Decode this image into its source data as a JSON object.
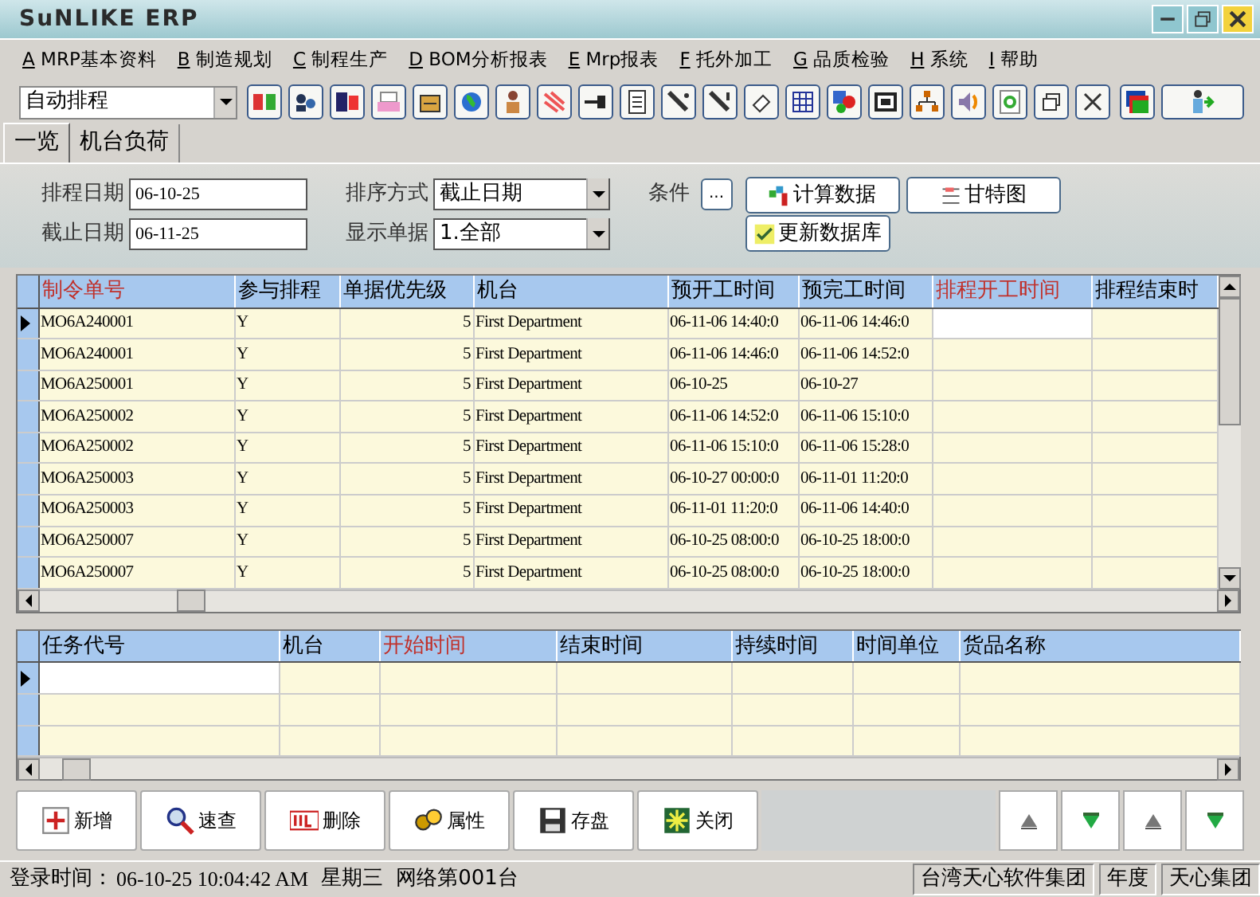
{
  "window": {
    "title": "SuNLIKE ERP"
  },
  "menu": [
    {
      "key": "A",
      "label": "MRP基本资料"
    },
    {
      "key": "B",
      "label": "制造规划"
    },
    {
      "key": "C",
      "label": "制程生产"
    },
    {
      "key": "D",
      "label": "BOM分析报表"
    },
    {
      "key": "E",
      "label": "Mrp报表"
    },
    {
      "key": "F",
      "label": "托外加工"
    },
    {
      "key": "G",
      "label": "品质检验"
    },
    {
      "key": "H",
      "label": "系统"
    },
    {
      "key": "I",
      "label": "帮助"
    }
  ],
  "toolbar": {
    "function_select": {
      "value": "自动排程"
    }
  },
  "tabs": [
    {
      "label": "一览",
      "selected": true
    },
    {
      "label": "机台负荷",
      "selected": false
    }
  ],
  "form": {
    "schedule_date": {
      "label": "排程日期",
      "value": "06-10-25"
    },
    "deadline": {
      "label": "截止日期",
      "value": "06-11-25"
    },
    "sort": {
      "label": "排序方式",
      "value": "截止日期"
    },
    "display": {
      "label": "显示单据",
      "value": "1.全部"
    },
    "condition": {
      "label": "条件",
      "button": "..."
    },
    "actions": [
      {
        "label": "计算数据",
        "kind": "calc"
      },
      {
        "label": "甘特图",
        "kind": "gantt"
      },
      {
        "label": "更新数据库",
        "kind": "update"
      }
    ]
  },
  "orders_table": {
    "columns": [
      {
        "label": "制令单号",
        "highlighted": true,
        "numeric": false,
        "current": false
      },
      {
        "label": "参与排程",
        "highlighted": false,
        "numeric": false,
        "current": false
      },
      {
        "label": "单据优先级",
        "highlighted": false,
        "numeric": true,
        "current": false
      },
      {
        "label": "机台",
        "highlighted": false,
        "numeric": false,
        "current": false
      },
      {
        "label": "预开工时间",
        "highlighted": false,
        "numeric": false,
        "current": false
      },
      {
        "label": "预完工时间",
        "highlighted": false,
        "numeric": false,
        "current": false
      },
      {
        "label": "排程开工时间",
        "highlighted": true,
        "numeric": false,
        "current": true
      },
      {
        "label": "排程结束时",
        "highlighted": false,
        "numeric": false,
        "current": false
      }
    ],
    "rows": [
      {
        "selected": true,
        "cells": [
          "MO6A240001",
          "Y",
          "5",
          "First Department",
          "06-11-06 14:40:0",
          "06-11-06 14:46:0",
          "",
          ""
        ]
      },
      {
        "selected": false,
        "cells": [
          "MO6A240001",
          "Y",
          "5",
          "First Department",
          "06-11-06 14:46:0",
          "06-11-06 14:52:0",
          "",
          ""
        ]
      },
      {
        "selected": false,
        "cells": [
          "MO6A250001",
          "Y",
          "5",
          "First Department",
          "06-10-25",
          "06-10-27",
          "",
          ""
        ]
      },
      {
        "selected": false,
        "cells": [
          "MO6A250002",
          "Y",
          "5",
          "First Department",
          "06-11-06 14:52:0",
          "06-11-06 15:10:0",
          "",
          ""
        ]
      },
      {
        "selected": false,
        "cells": [
          "MO6A250002",
          "Y",
          "5",
          "First Department",
          "06-11-06 15:10:0",
          "06-11-06 15:28:0",
          "",
          ""
        ]
      },
      {
        "selected": false,
        "cells": [
          "MO6A250003",
          "Y",
          "5",
          "First Department",
          "06-10-27 00:00:0",
          "06-11-01 11:20:0",
          "",
          ""
        ]
      },
      {
        "selected": false,
        "cells": [
          "MO6A250003",
          "Y",
          "5",
          "First Department",
          "06-11-01 11:20:0",
          "06-11-06 14:40:0",
          "",
          ""
        ]
      },
      {
        "selected": false,
        "cells": [
          "MO6A250007",
          "Y",
          "5",
          "First Department",
          "06-10-25 08:00:0",
          "06-10-25 18:00:0",
          "",
          ""
        ]
      },
      {
        "selected": false,
        "cells": [
          "MO6A250007",
          "Y",
          "5",
          "First Department",
          "06-10-25 08:00:0",
          "06-10-25 18:00:0",
          "",
          ""
        ]
      }
    ]
  },
  "tasks_table": {
    "columns": [
      {
        "label": "任务代号",
        "highlighted": false,
        "current": true
      },
      {
        "label": "机台",
        "highlighted": false,
        "current": false
      },
      {
        "label": "开始时间",
        "highlighted": true,
        "current": false
      },
      {
        "label": "结束时间",
        "highlighted": false,
        "current": false
      },
      {
        "label": "持续时间",
        "highlighted": false,
        "current": false
      },
      {
        "label": "时间单位",
        "highlighted": false,
        "current": false
      },
      {
        "label": "货品名称",
        "highlighted": false,
        "current": false
      }
    ],
    "rows": [
      {
        "selected": true,
        "cells": [
          "",
          "",
          "",
          "",
          "",
          "",
          ""
        ]
      },
      {
        "selected": false,
        "cells": [
          "",
          "",
          "",
          "",
          "",
          "",
          ""
        ]
      },
      {
        "selected": false,
        "cells": [
          "",
          "",
          "",
          "",
          "",
          "",
          ""
        ]
      }
    ]
  },
  "buttons": [
    {
      "label": "新增",
      "kind": "add"
    },
    {
      "label": "速查",
      "kind": "search"
    },
    {
      "label": "删除",
      "kind": "delete"
    },
    {
      "label": "属性",
      "kind": "properties"
    },
    {
      "label": "存盘",
      "kind": "save"
    },
    {
      "label": "关闭",
      "kind": "close"
    }
  ],
  "status_bar": {
    "login_label": "登录时间：",
    "login_time": "06-10-25 10:04:42 AM",
    "weekday": "星期三",
    "terminal": "网络第001台",
    "panels": [
      "台湾天心软件集团",
      "年度",
      "天心集团"
    ]
  }
}
